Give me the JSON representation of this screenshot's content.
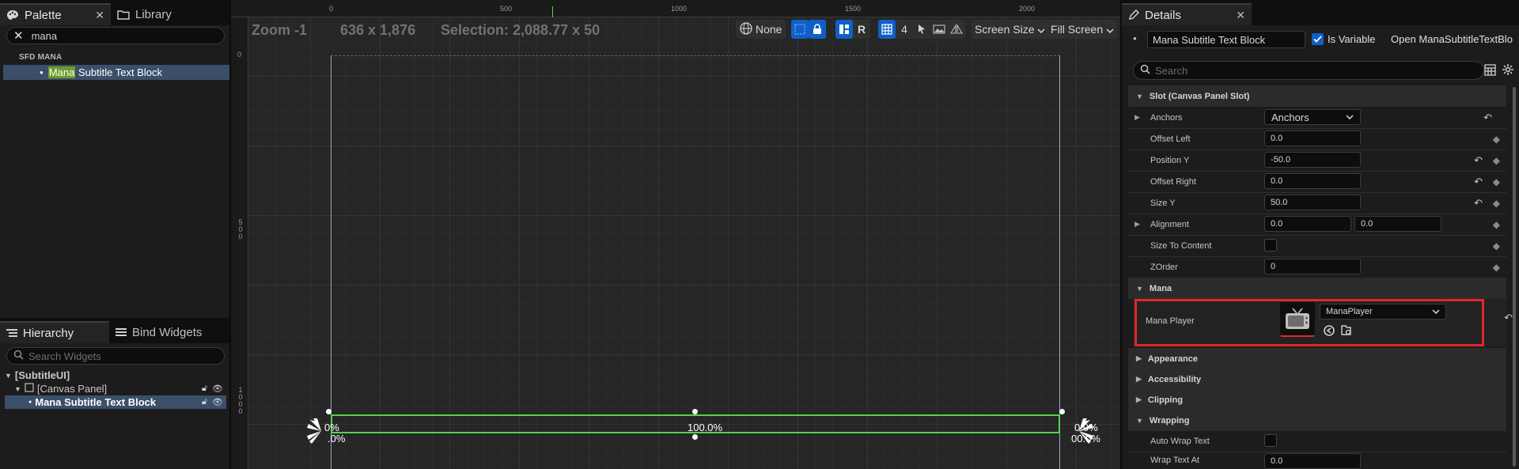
{
  "palette_panel": {
    "tabs": [
      {
        "label": "Palette"
      },
      {
        "label": "Library"
      }
    ],
    "search_value": "mana",
    "category": "SFD MANA",
    "item_highlight": "Mana",
    "item_rest": " Subtitle Text Block"
  },
  "hierarchy_panel": {
    "tabs": [
      {
        "label": "Hierarchy"
      },
      {
        "label": "Bind Widgets"
      }
    ],
    "search_placeholder": "Search Widgets",
    "tree": [
      {
        "label": "[SubtitleUI]"
      },
      {
        "label": "[Canvas Panel]"
      },
      {
        "label": "Mana Subtitle Text Block"
      }
    ]
  },
  "viewport": {
    "zoom_label": "Zoom -1",
    "resolution": "636 x 1,876",
    "selection": "Selection: 2,088.77 x 50",
    "ruler_top_ticks": [
      "0",
      "500",
      "1000",
      "1500",
      "2000"
    ],
    "ruler_left_ticks": [
      "0",
      "500",
      "1000"
    ],
    "toolbar": {
      "localization": "None",
      "snap_r": "R",
      "grid_value": "4",
      "screen_size": "Screen Size",
      "fill_screen": "Fill Screen"
    },
    "percent_center": "100.0%",
    "percent_left": "0%",
    "percent_left_b": ".0%",
    "percent_right": "0.0%",
    "percent_right_b": "00.0%"
  },
  "details": {
    "tab_label": "Details",
    "widget_name": "Mana Subtitle Text Block",
    "is_variable_label": "Is Variable",
    "is_variable_checked": true,
    "open_link": "Open ManaSubtitleTextBlo",
    "search_placeholder": "Search",
    "sections": {
      "slot": "Slot (Canvas Panel Slot)",
      "mana": "Mana",
      "appearance": "Appearance",
      "accessibility": "Accessibility",
      "clipping": "Clipping",
      "wrapping": "Wrapping"
    },
    "props": {
      "anchors": {
        "label": "Anchors",
        "value": "Anchors"
      },
      "offset_left": {
        "label": "Offset Left",
        "value": "0.0"
      },
      "position_y": {
        "label": "Position Y",
        "value": "-50.0"
      },
      "offset_right": {
        "label": "Offset Right",
        "value": "0.0"
      },
      "size_y": {
        "label": "Size Y",
        "value": "50.0"
      },
      "alignment": {
        "label": "Alignment",
        "x": "0.0",
        "y": "0.0"
      },
      "size_to_content": {
        "label": "Size To Content",
        "checked": false
      },
      "zorder": {
        "label": "ZOrder",
        "value": "0"
      },
      "mana_player": {
        "label": "Mana Player",
        "value": "ManaPlayer"
      },
      "auto_wrap": {
        "label": "Auto Wrap Text",
        "checked": false
      },
      "wrap_text_at": {
        "label": "Wrap Text At",
        "value": "0.0"
      }
    }
  },
  "colors": {
    "accent_blue": "#0f5fc8",
    "selection_green": "#53d34c",
    "highlight_red": "#e1262c",
    "search_highlight": "#6c9c2e"
  }
}
